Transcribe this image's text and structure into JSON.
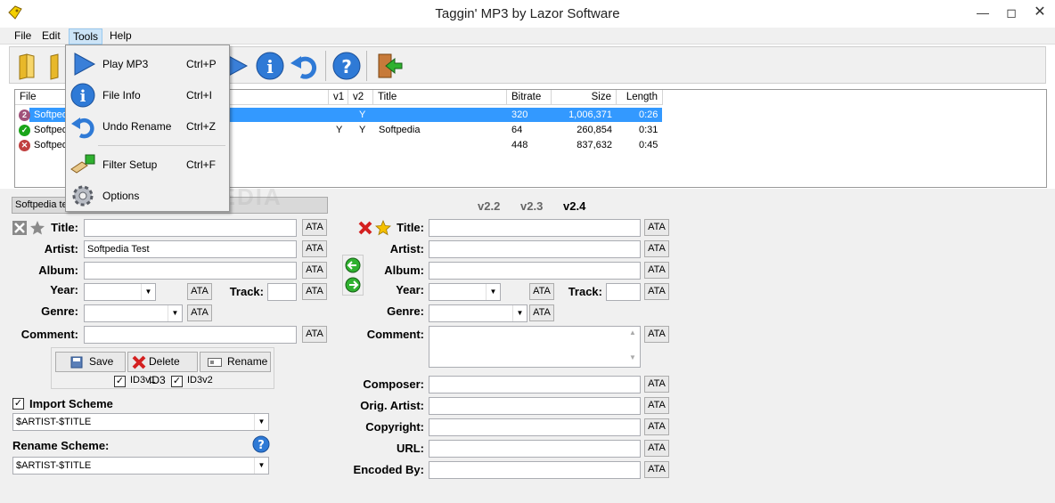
{
  "window": {
    "title": "Taggin' MP3   by Lazor Software"
  },
  "menubar": {
    "items": [
      "File",
      "Edit",
      "Tools",
      "Help"
    ]
  },
  "tools_menu": {
    "items": [
      {
        "label": "Play MP3",
        "shortcut": "Ctrl+P",
        "icon": "play-icon"
      },
      {
        "label": "File Info",
        "shortcut": "Ctrl+I",
        "icon": "info-icon"
      },
      {
        "label": "Undo Rename",
        "shortcut": "Ctrl+Z",
        "icon": "undo-icon"
      },
      {
        "label": "Filter Setup",
        "shortcut": "Ctrl+F",
        "icon": "filter-icon"
      },
      {
        "label": "Options",
        "shortcut": "",
        "icon": "gear-icon"
      }
    ]
  },
  "filelist": {
    "headers": [
      "File",
      "v1",
      "v2",
      "Title",
      "Bitrate",
      "Size",
      "Length"
    ],
    "rows": [
      {
        "file": "Softpedia",
        "v1": "",
        "v2": "Y",
        "title": "",
        "bitrate": "320",
        "size": "1,006,371",
        "length": "0:26",
        "status": "2",
        "status_color": "#a0527a",
        "selected": true
      },
      {
        "file": "Softpedia",
        "v1": "Y",
        "v2": "Y",
        "title": "Softpedia",
        "bitrate": "64",
        "size": "260,854",
        "length": "0:31",
        "status": "✓",
        "status_color": "#1aa51a",
        "selected": false
      },
      {
        "file": "Softpedia",
        "v1": "",
        "v2": "",
        "title": "",
        "bitrate": "448",
        "size": "837,632",
        "length": "0:45",
        "status": "✕",
        "status_color": "#c04040",
        "selected": false
      }
    ]
  },
  "left_panel": {
    "file_name": "Softpedia te",
    "labels": {
      "title": "Title:",
      "artist": "Artist:",
      "album": "Album:",
      "year": "Year:",
      "track": "Track:",
      "genre": "Genre:",
      "comment": "Comment:"
    },
    "values": {
      "title": "",
      "artist": "Softpedia Test",
      "album": "",
      "year": "",
      "track": "",
      "genre": "",
      "comment": ""
    },
    "ata": "ATA",
    "buttons": {
      "save": "Save",
      "delete": "Delete ID3",
      "rename": "Rename"
    },
    "checkboxes": {
      "id3v1": "ID3v1",
      "id3v2": "ID3v2"
    },
    "import_scheme": {
      "label": "Import Scheme",
      "value": "$ARTIST-$TITLE",
      "checked": true
    },
    "rename_scheme": {
      "label": "Rename Scheme:",
      "value": "$ARTIST-$TITLE"
    }
  },
  "right_panel": {
    "versions": [
      "v2.2",
      "v2.3",
      "v2.4"
    ],
    "active_version": "v2.4",
    "labels": {
      "title": "Title:",
      "artist": "Artist:",
      "album": "Album:",
      "year": "Year:",
      "track": "Track:",
      "genre": "Genre:",
      "comment": "Comment:",
      "composer": "Composer:",
      "orig_artist": "Orig. Artist:",
      "copyright": "Copyright:",
      "url": "URL:",
      "encoded_by": "Encoded By:"
    },
    "ata": "ATA"
  },
  "watermark": "SOFTPEDIA"
}
